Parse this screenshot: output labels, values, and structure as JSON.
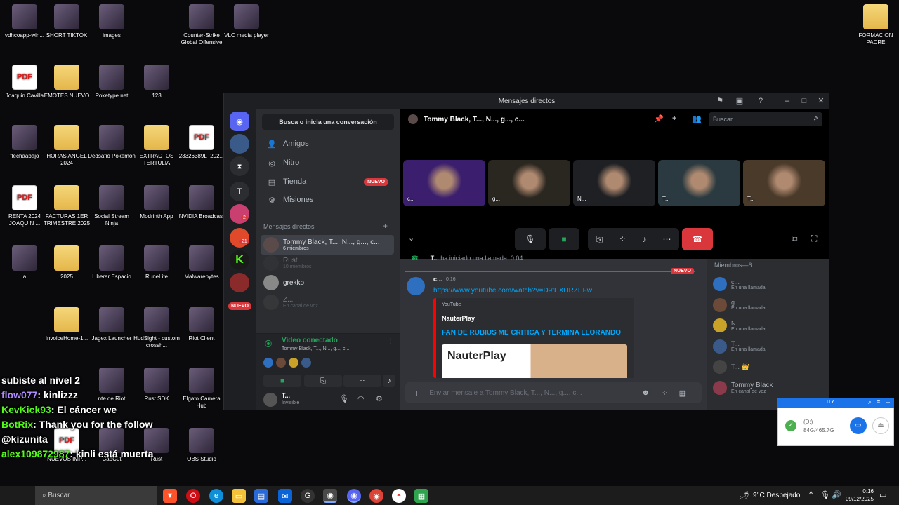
{
  "desktop_icons": [
    {
      "label": "vdhcoapp-win...",
      "kind": "img"
    },
    {
      "label": "SHORT TIKTOK",
      "kind": "img"
    },
    {
      "label": "images",
      "kind": "img"
    },
    {
      "label": "Counter-Strike Global Offensive",
      "kind": "img"
    },
    {
      "label": "VLC media player",
      "kind": "img"
    },
    {
      "label": "FORMACION PADRE",
      "kind": "folder"
    },
    {
      "label": "Joaquin Cavilla",
      "kind": "pdf"
    },
    {
      "label": "EMOTES NUEVO",
      "kind": "folder"
    },
    {
      "label": "Poketype.net",
      "kind": "img"
    },
    {
      "label": "123",
      "kind": "img"
    },
    {
      "label": "flechaabajo",
      "kind": "img"
    },
    {
      "label": "HORAS ANGEL 2024",
      "kind": "folder"
    },
    {
      "label": "Dedsafio Pokemon",
      "kind": "img"
    },
    {
      "label": "EXTRACTOS TERTULIA",
      "kind": "folder"
    },
    {
      "label": "23326389L_202...",
      "kind": "pdf"
    },
    {
      "label": "RENTA 2024 JOAQUIN ...",
      "kind": "pdf"
    },
    {
      "label": "FACTURAS 1ER TRIMESTRE 2025",
      "kind": "folder"
    },
    {
      "label": "Social Stream Ninja",
      "kind": "img"
    },
    {
      "label": "Modrinth App",
      "kind": "img"
    },
    {
      "label": "NVIDIA Broadcast",
      "kind": "img"
    },
    {
      "label": "a",
      "kind": "img"
    },
    {
      "label": "2025",
      "kind": "folder"
    },
    {
      "label": "Liberar Espacio",
      "kind": "img"
    },
    {
      "label": "RuneLite",
      "kind": "img"
    },
    {
      "label": "Malwarebytes",
      "kind": "img"
    },
    {
      "label": "InvoiceHome-1...",
      "kind": "folder"
    },
    {
      "label": "Jagex Launcher",
      "kind": "img"
    },
    {
      "label": "HudSight - custom crossh...",
      "kind": "img"
    },
    {
      "label": "Riot Client",
      "kind": "img"
    },
    {
      "label": "nte de Riot",
      "kind": "img"
    },
    {
      "label": "Rust SDK",
      "kind": "img"
    },
    {
      "label": "Elgato Camera Hub",
      "kind": "img"
    },
    {
      "label": "NUEVOS IMP...",
      "kind": "pdf"
    },
    {
      "label": "CapCut",
      "kind": "img"
    },
    {
      "label": "Rust",
      "kind": "img"
    },
    {
      "label": "OBS Studio",
      "kind": "img"
    }
  ],
  "window": {
    "title": "Mensajes directos",
    "search_conv": "Busca o inicia una conversación",
    "nav": [
      {
        "label": "Amigos",
        "icon": "friends-icon",
        "glyph": "👤"
      },
      {
        "label": "Nitro",
        "icon": "nitro-icon",
        "glyph": "◎"
      },
      {
        "label": "Tienda",
        "icon": "shop-icon",
        "glyph": "🏪"
      },
      {
        "label": "Misiones",
        "icon": "quests-icon",
        "glyph": "⚙"
      }
    ],
    "new_badge": "NUEVO",
    "dm_header": "Mensajes directos",
    "dms": [
      {
        "name": "Tommy Black, T..., N..., g..., c...",
        "sub": "6 miembros",
        "active": true,
        "color": "#5b4a4a"
      },
      {
        "name": "Rust",
        "sub": "10 miembros",
        "active": false,
        "color": "#3a3a3a"
      },
      {
        "name": "grekko",
        "sub": "",
        "active": false,
        "color": "#888"
      },
      {
        "name": "Z...",
        "sub": "En canal de voz",
        "active": false,
        "color": "#444"
      }
    ],
    "server_badges": [
      "2",
      "21"
    ],
    "server_letters": [
      "T"
    ],
    "voice": {
      "status": "Video conectado",
      "channel": "Tommy Black, T..., N..., g..., c..."
    },
    "user": {
      "name": "T...",
      "status": "Invisible"
    },
    "call": {
      "title": "Tommy Black, T..., N..., g..., c...",
      "search": "Buscar",
      "tiles": [
        {
          "label": "c...",
          "color": "#3b1f6e"
        },
        {
          "label": "g...",
          "color": "#2a2620"
        },
        {
          "label": "N...",
          "color": "#1e2024"
        },
        {
          "label": "T...",
          "color": "#2a3a40"
        },
        {
          "label": "T...",
          "color": "#4a3a2a"
        }
      ]
    },
    "chat": {
      "system_user": "T...",
      "system_text": "ha iniciado una llamada.",
      "system_time": "0:04",
      "new_label": "NUEVO",
      "msg_author": "c...",
      "msg_time": "0:16",
      "link": "https://www.youtube.com/watch?v=D9tEXHRZEFw",
      "embed_provider": "YouTube",
      "embed_author": "NauterPlay",
      "embed_title": "FAN DE RUBIUS ME CRITICA Y TERMINA LLORANDO",
      "thumb_text": "NauterPlay",
      "composer_placeholder": "Enviar mensaje a Tommy Black, T..., N..., g..., c..."
    },
    "members_header": "Miembros—6",
    "members": [
      {
        "name": "c...",
        "status": "En una llamada",
        "color": "#2f6fbf"
      },
      {
        "name": "g...",
        "status": "En una llamada",
        "color": "#6b4a3a"
      },
      {
        "name": "N...",
        "status": "En una llamada",
        "color": "#c9a227"
      },
      {
        "name": "T...",
        "status": "En una llamada",
        "color": "#3a5a8a"
      },
      {
        "name": "T... 👑",
        "status": "",
        "color": "#444"
      },
      {
        "name": "Tommy Black",
        "status": "En canal de voz",
        "color": "#8a3a4a"
      }
    ]
  },
  "twitch_chat": [
    {
      "user": "",
      "text": "subiste al nivel 2",
      "color": "#ffffff"
    },
    {
      "user": "flow077",
      "text": ": kinlizzz",
      "color": "#b08cff"
    },
    {
      "user": "KevKick93",
      "text": ": El cáncer we",
      "color": "#53fc18"
    },
    {
      "user": "BotRix",
      "text": ": Thank you for the follow @kizunita",
      "color": "#53fc18"
    },
    {
      "user": "alex109872987",
      "text": ": kinli está muerta",
      "color": "#53fc18"
    }
  ],
  "usb_popup": {
    "drive": "(D:)",
    "size": "84G/465.7G",
    "header": "ITY"
  },
  "taskbar": {
    "search": "Buscar",
    "weather": "9°C  Despejado",
    "time": "0:16",
    "date": "09/12/2025"
  }
}
